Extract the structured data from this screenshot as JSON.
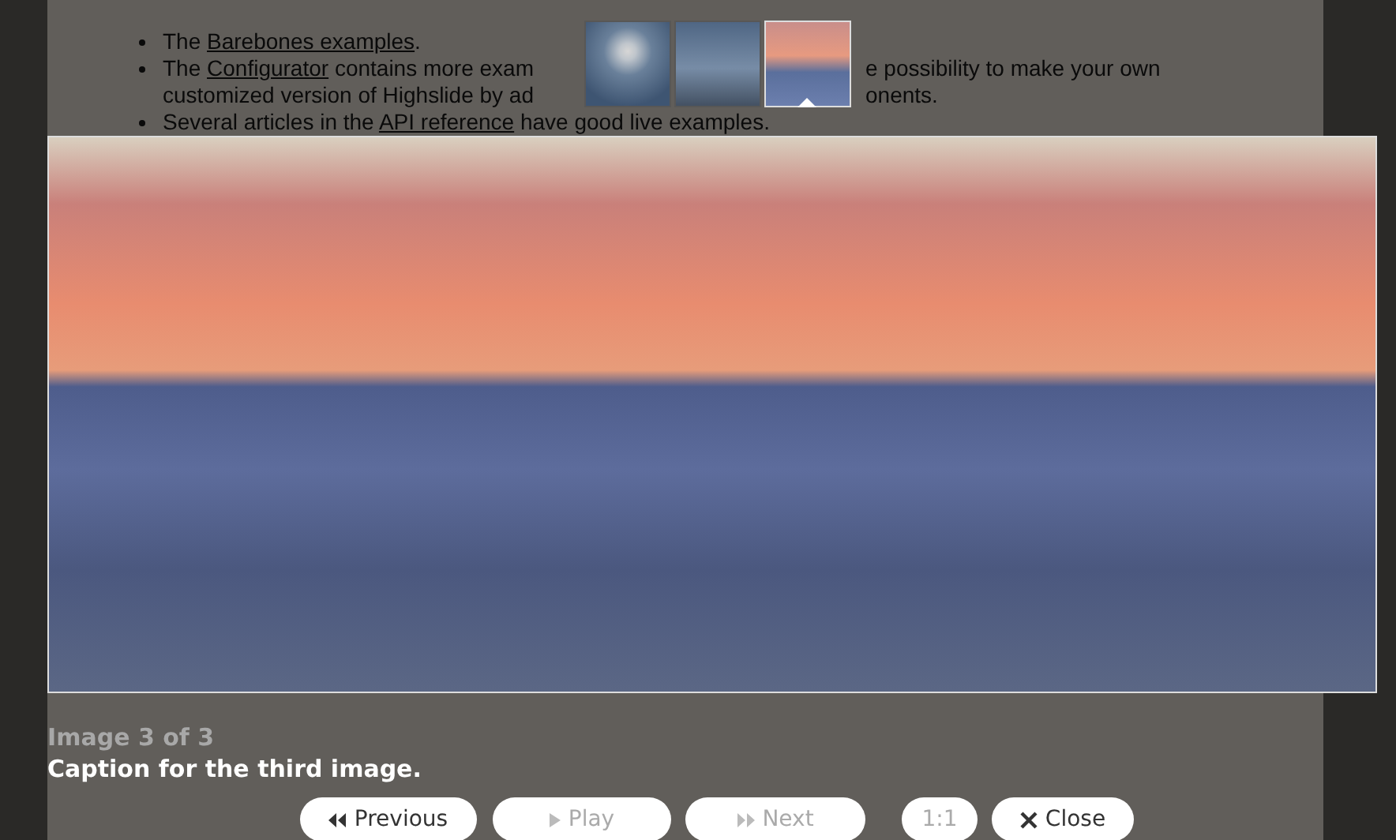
{
  "page": {
    "bullets": [
      {
        "fragments": [
          {
            "text": "The ",
            "link": false
          },
          {
            "text": "Barebones examples",
            "link": true
          },
          {
            "text": ".",
            "link": false
          }
        ]
      },
      {
        "fragments": [
          {
            "text": "The ",
            "link": false
          },
          {
            "text": "Configurator",
            "link": true
          },
          {
            "text": " contains more exam",
            "link": false
          }
        ],
        "tail": "e possibility to make your own",
        "line2": "customized version of Highslide by ad",
        "line2_tail": "onents."
      },
      {
        "fragments": [
          {
            "text": "Several articles in the ",
            "link": false
          },
          {
            "text": "API reference",
            "link": true
          },
          {
            "text": " have good live examples.",
            "link": false
          }
        ]
      }
    ]
  },
  "thumbnails": [
    {
      "kind": "sun",
      "selected": false
    },
    {
      "kind": "tree",
      "selected": false
    },
    {
      "kind": "sunset",
      "selected": true
    }
  ],
  "counter": "Image 3 of 3",
  "caption": "Caption for the third image.",
  "controls": [
    {
      "kind": "previous",
      "label": "Previous",
      "disabled": false
    },
    {
      "kind": "play",
      "label": "Play",
      "disabled": true
    },
    {
      "kind": "next",
      "label": "Next",
      "disabled": true
    },
    {
      "kind": "ratio",
      "label": "1:1",
      "disabled": true
    },
    {
      "kind": "close",
      "label": "Close",
      "disabled": false
    }
  ]
}
